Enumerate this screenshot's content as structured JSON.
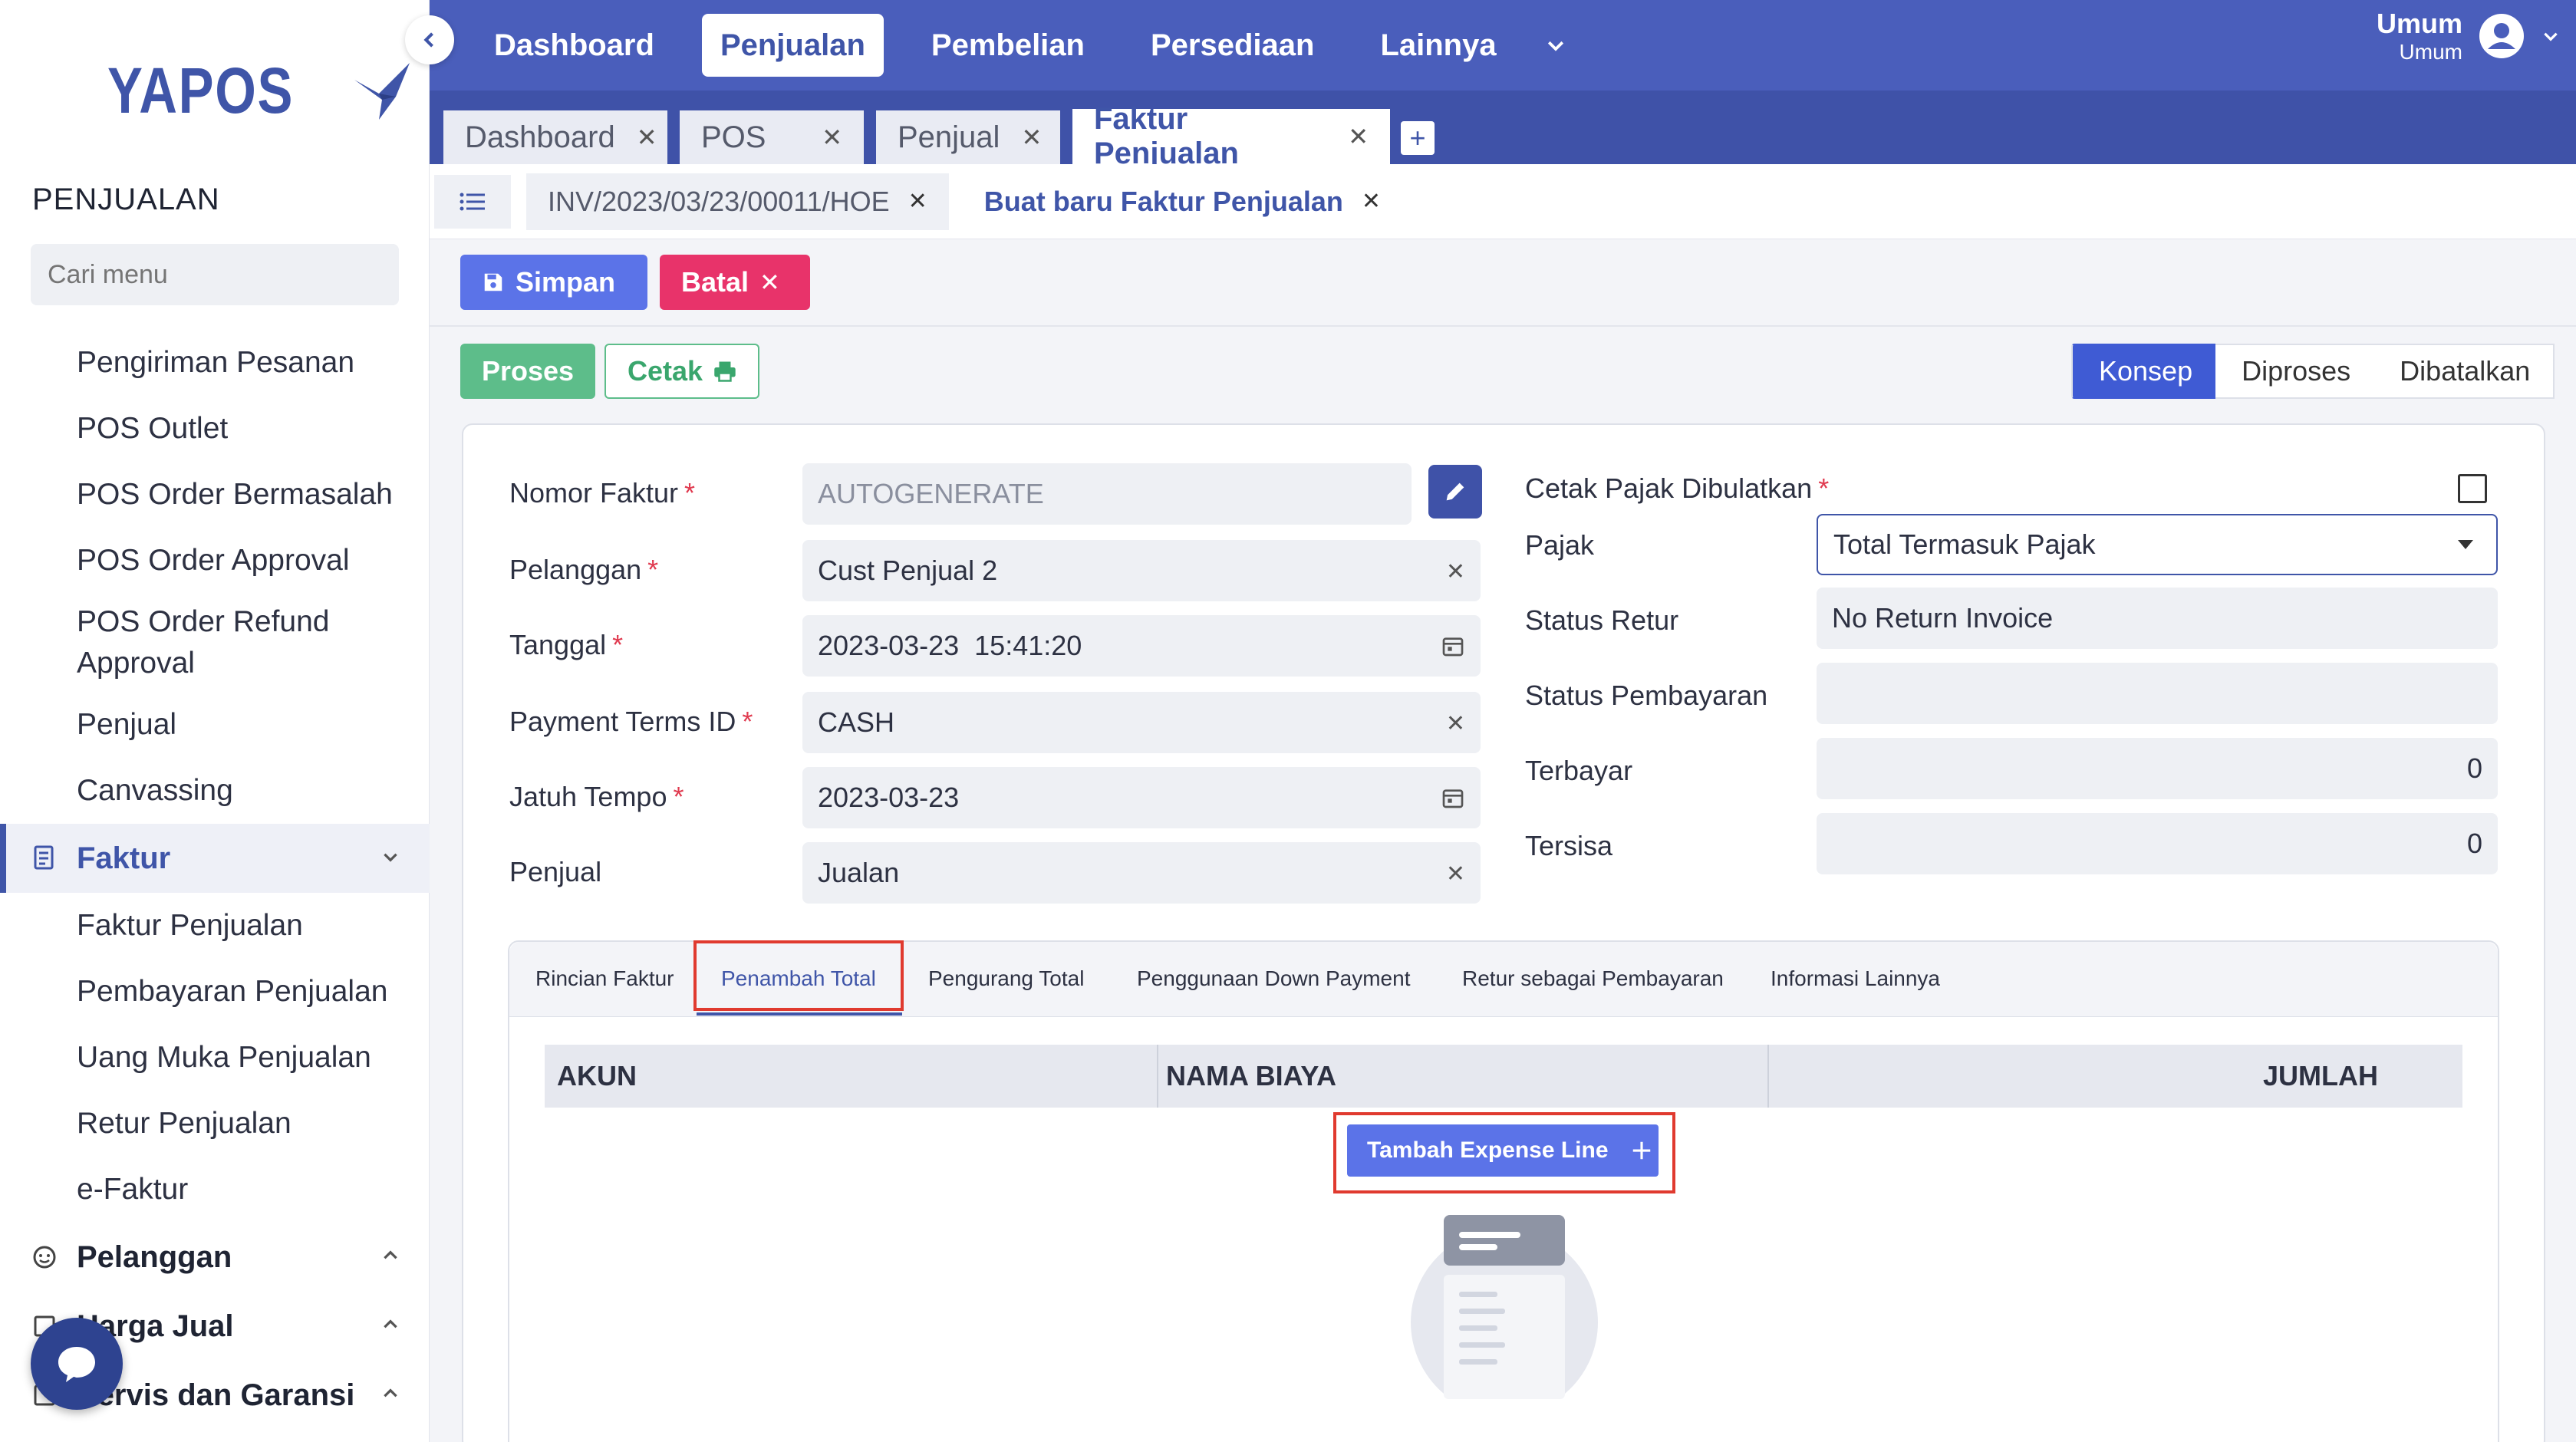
{
  "sidebar": {
    "logo_text": "YAPOS",
    "section_title": "PENJUALAN",
    "search_placeholder": "Cari menu",
    "items_top": [
      {
        "label": "Pengiriman Pesanan"
      },
      {
        "label": "POS Outlet"
      },
      {
        "label": "POS Order Bermasalah"
      },
      {
        "label": "POS Order Approval"
      },
      {
        "label": "POS Order Refund Approval"
      },
      {
        "label": "Penjual"
      },
      {
        "label": "Canvassing"
      }
    ],
    "group_faktur": {
      "label": "Faktur",
      "icon": "invoice-icon",
      "expanded": true
    },
    "items_faktur": [
      {
        "label": "Faktur Penjualan"
      },
      {
        "label": "Pembayaran Penjualan"
      },
      {
        "label": "Uang Muka Penjualan"
      },
      {
        "label": "Retur Penjualan"
      },
      {
        "label": "e-Faktur"
      }
    ],
    "groups_bottom": [
      {
        "label": "Pelanggan",
        "icon": "customer-icon"
      },
      {
        "label": "Harga Jual",
        "icon": "price-icon"
      },
      {
        "label": "Servis dan Garansi",
        "icon": "service-icon"
      }
    ]
  },
  "topnav": {
    "items": [
      {
        "label": "Dashboard"
      },
      {
        "label": "Penjualan",
        "active": true
      },
      {
        "label": "Pembelian"
      },
      {
        "label": "Persediaan"
      },
      {
        "label": "Lainnya"
      }
    ],
    "user_name": "Umum",
    "user_role": "Umum"
  },
  "tabs1": [
    {
      "label": "Dashboard"
    },
    {
      "label": "POS"
    },
    {
      "label": "Penjual"
    },
    {
      "label": "Faktur Penjualan",
      "active": true
    }
  ],
  "tabs2": [
    {
      "label": "INV/2023/03/23/00011/HOE"
    },
    {
      "label": "Buat baru Faktur Penjualan",
      "active": true
    }
  ],
  "actions": {
    "save": "Simpan",
    "cancel": "Batal",
    "process": "Proses",
    "print": "Cetak"
  },
  "status_steps": [
    "Konsep",
    "Diproses",
    "Dibatalkan"
  ],
  "status_active": "Konsep",
  "form": {
    "nomor_faktur": {
      "label": "Nomor Faktur",
      "value": "AUTOGENERATE"
    },
    "pelanggan": {
      "label": "Pelanggan",
      "value": "Cust Penjual 2"
    },
    "tanggal": {
      "label": "Tanggal",
      "value": "2023-03-23  15:41:20"
    },
    "payment_terms": {
      "label": "Payment Terms ID",
      "value": "CASH"
    },
    "jatuh_tempo": {
      "label": "Jatuh Tempo",
      "value": "2023-03-23"
    },
    "penjual": {
      "label": "Penjual",
      "value": "Jualan"
    },
    "cetak_pajak": {
      "label": "Cetak Pajak Dibulatkan",
      "checked": false
    },
    "pajak": {
      "label": "Pajak",
      "value": "Total Termasuk Pajak"
    },
    "status_retur": {
      "label": "Status Retur",
      "value": "No Return Invoice"
    },
    "status_pembayaran": {
      "label": "Status Pembayaran",
      "value": ""
    },
    "terbayar": {
      "label": "Terbayar",
      "value": "0"
    },
    "tersisa": {
      "label": "Tersisa",
      "value": "0"
    }
  },
  "inner_tabs": [
    {
      "label": "Rincian Faktur"
    },
    {
      "label": "Penambah Total",
      "active": true
    },
    {
      "label": "Pengurang Total"
    },
    {
      "label": "Penggunaan Down Payment"
    },
    {
      "label": "Retur sebagai Pembayaran"
    },
    {
      "label": "Informasi Lainnya"
    }
  ],
  "table": {
    "headers": [
      "AKUN",
      "NAMA BIAYA",
      "JUMLAH"
    ]
  },
  "add_expense_line": "Tambah Expense Line",
  "colors": {
    "primary": "#4a5ebb",
    "accent": "#5b73e8",
    "danger": "#e8336a",
    "success": "#5dbd8a",
    "highlight": "#e03a2f"
  }
}
